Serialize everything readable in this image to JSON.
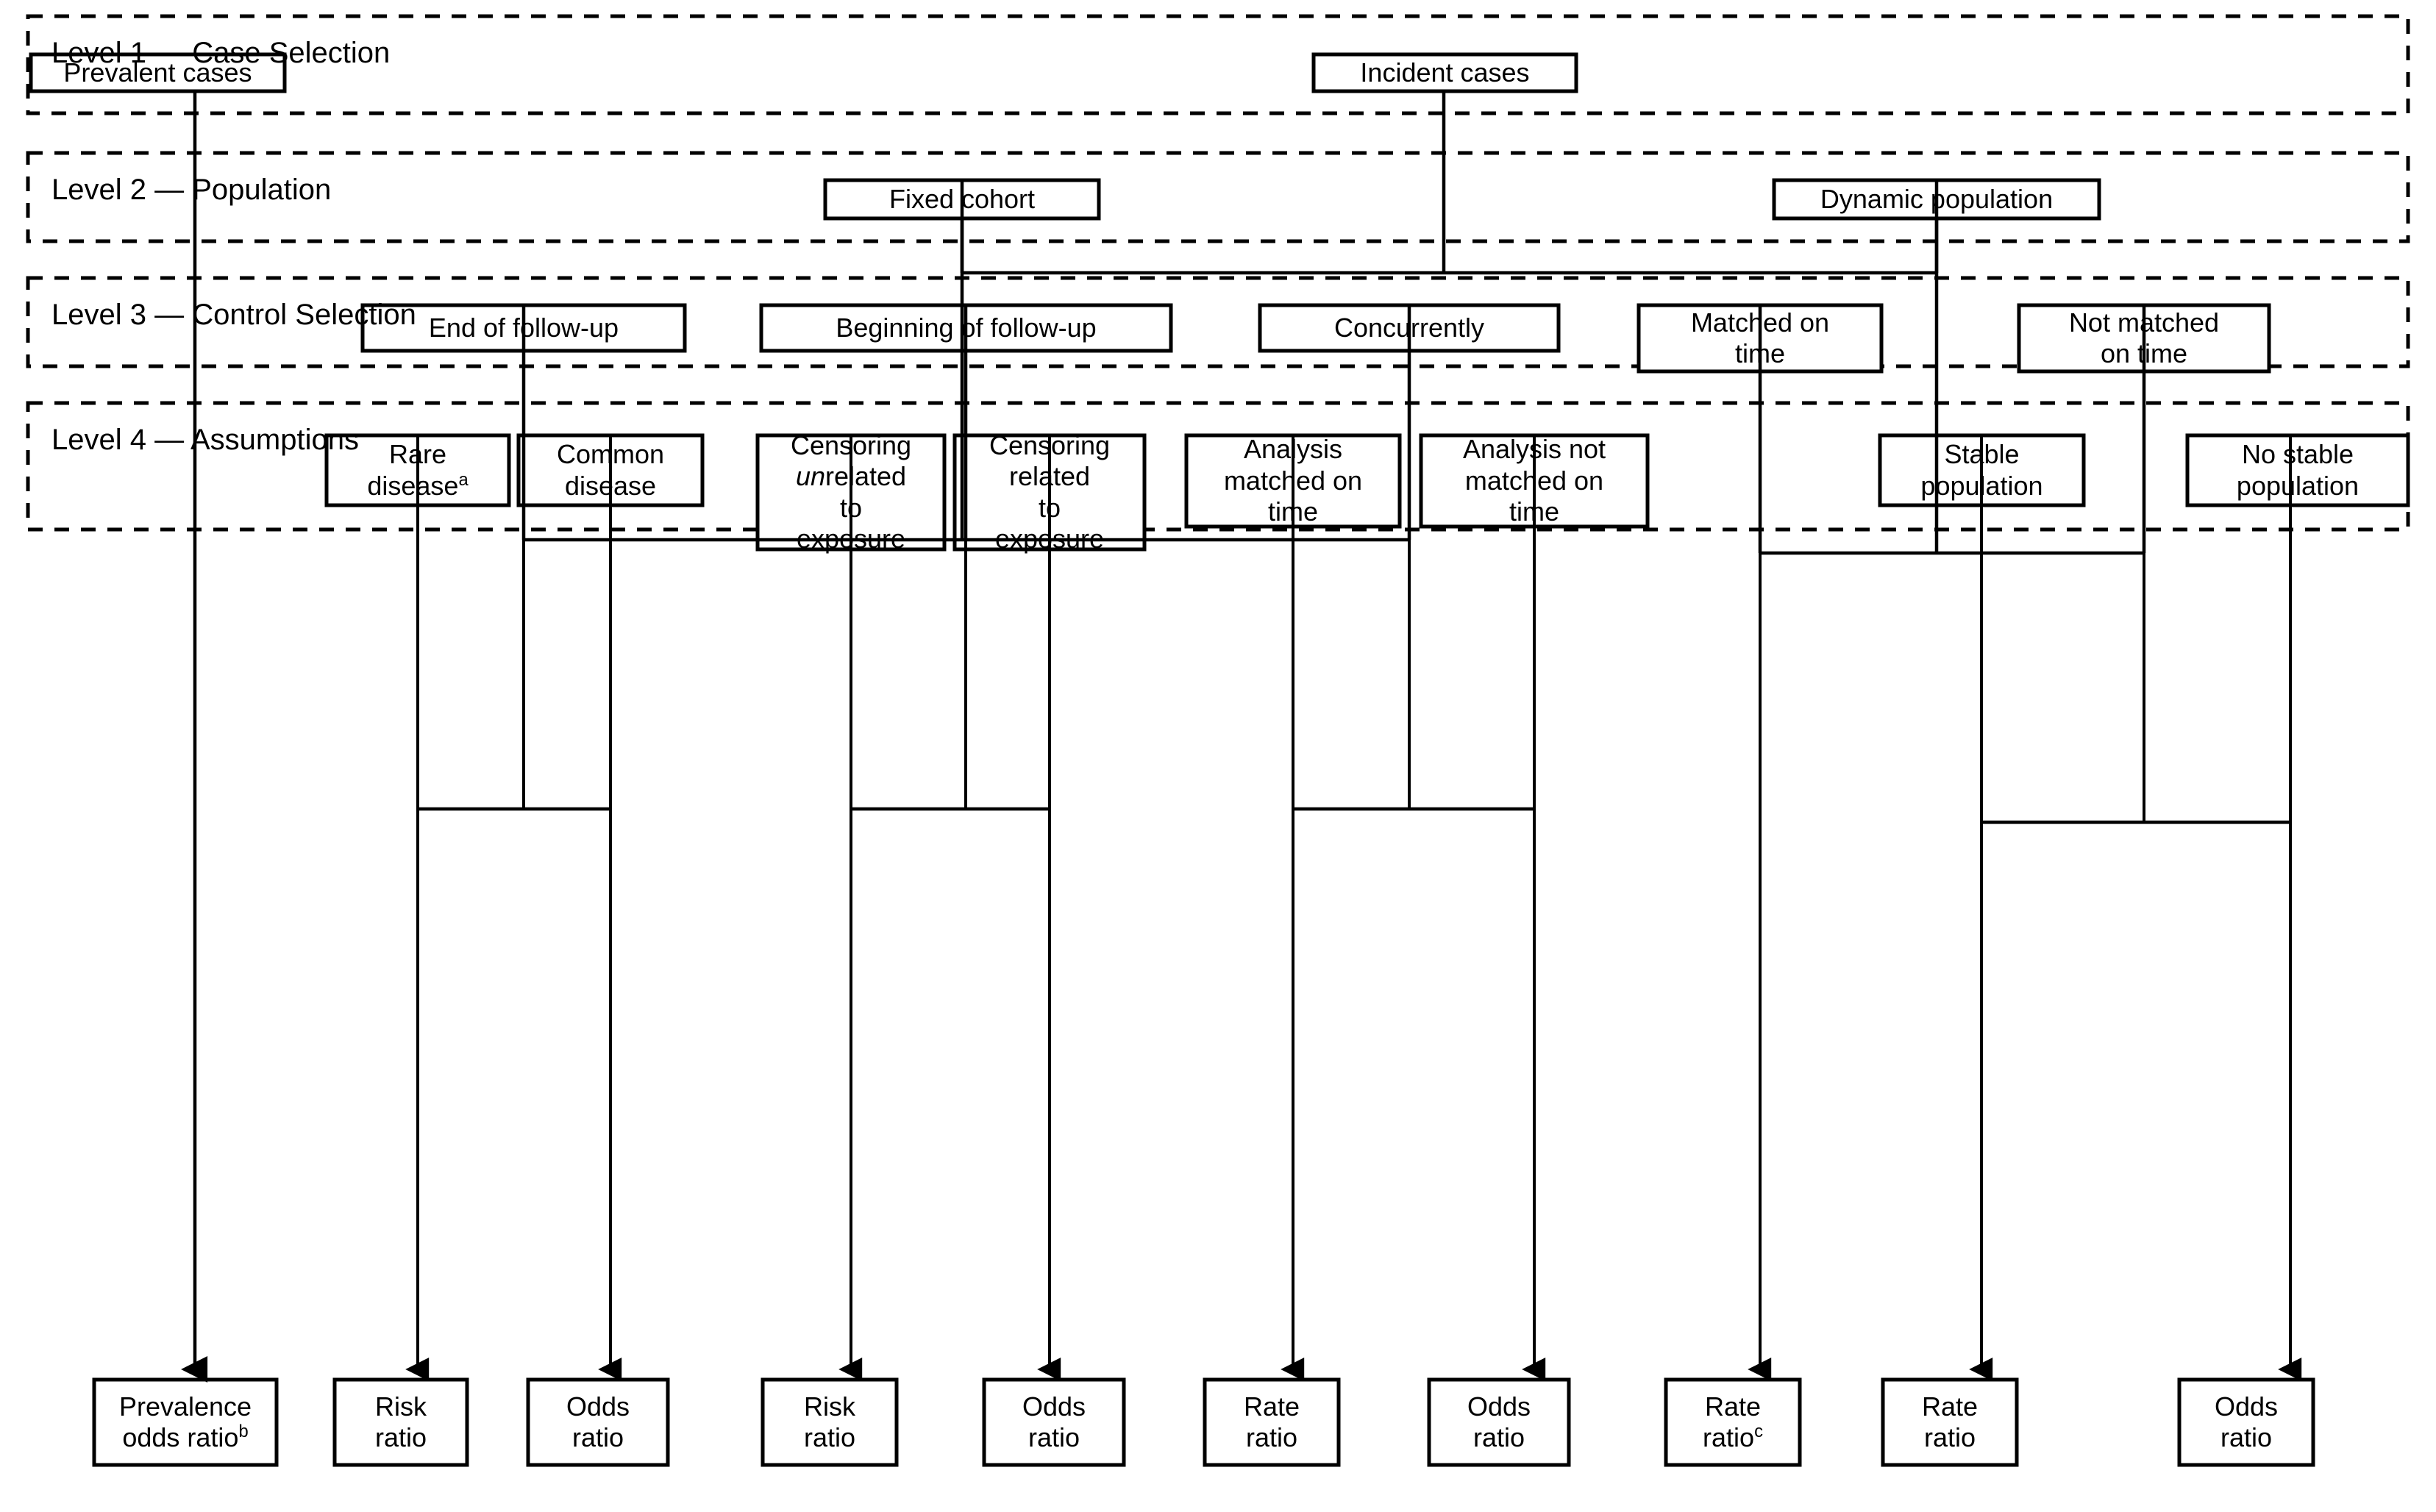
{
  "diagram": {
    "title_text": "",
    "levels": [
      {
        "id": "level1",
        "label": "Level 1 — Case Selection"
      },
      {
        "id": "level2",
        "label": "Level 2 — Population"
      },
      {
        "id": "level3",
        "label": "Level 3 — Control Selection"
      },
      {
        "id": "level4",
        "label": "Level 4 — Assumptions"
      }
    ],
    "level1_nodes": [
      {
        "id": "prevalent-cases",
        "label": "Prevalent cases"
      },
      {
        "id": "incident-cases",
        "label": "Incident cases"
      }
    ],
    "level2_nodes": [
      {
        "id": "fixed-cohort",
        "label": "Fixed cohort"
      },
      {
        "id": "dynamic-population",
        "label": "Dynamic population"
      }
    ],
    "level3_nodes": [
      {
        "id": "end-of-follow-up",
        "label": "End of follow-up"
      },
      {
        "id": "beginning-of-follow-up",
        "label": "Beginning of follow-up"
      },
      {
        "id": "concurrently",
        "label": "Concurrently"
      },
      {
        "id": "matched-on-time",
        "label": "Matched on\ntime"
      },
      {
        "id": "not-matched-on-time",
        "label": "Not matched\non time"
      }
    ],
    "level4_nodes": [
      {
        "id": "rare-disease",
        "label_prefix": "Rare\ndisease",
        "superscript": "a"
      },
      {
        "id": "common-disease",
        "label": "Common\ndisease"
      },
      {
        "id": "censoring-unrelated",
        "label_italic_part": "un",
        "label_line1": "Censoring",
        "label_rest": "related\nto\nexposure"
      },
      {
        "id": "censoring-related",
        "label": "Censoring\nrelated\nto\nexposure"
      },
      {
        "id": "analysis-matched-on-time",
        "label": "Analysis\nmatched on\ntime"
      },
      {
        "id": "analysis-not-matched-on-time",
        "label": "Analysis not\nmatched on\ntime"
      },
      {
        "id": "stable-population",
        "label": "Stable\npopulation"
      },
      {
        "id": "no-stable-population",
        "label": "No stable\npopulation"
      }
    ],
    "outcome_nodes": [
      {
        "id": "prevalence-odds-ratio",
        "label_prefix": "Prevalence\nodds ratio",
        "superscript": "b"
      },
      {
        "id": "risk-ratio-1",
        "label": "Risk\nratio"
      },
      {
        "id": "odds-ratio-1",
        "label": "Odds\nratio"
      },
      {
        "id": "risk-ratio-2",
        "label": "Risk\nratio"
      },
      {
        "id": "odds-ratio-2",
        "label": "Odds\nratio"
      },
      {
        "id": "rate-ratio-1",
        "label": "Rate\nratio"
      },
      {
        "id": "odds-ratio-3",
        "label": "Odds\nratio"
      },
      {
        "id": "rate-ratio-2",
        "label_prefix": "Rate\nratio",
        "superscript": "c"
      },
      {
        "id": "rate-ratio-3",
        "label": "Rate\nratio"
      },
      {
        "id": "odds-ratio-4",
        "label": "Odds\nratio"
      }
    ],
    "colors": {
      "stroke": "#000000",
      "fill": "#ffffff",
      "text": "#000000"
    }
  }
}
